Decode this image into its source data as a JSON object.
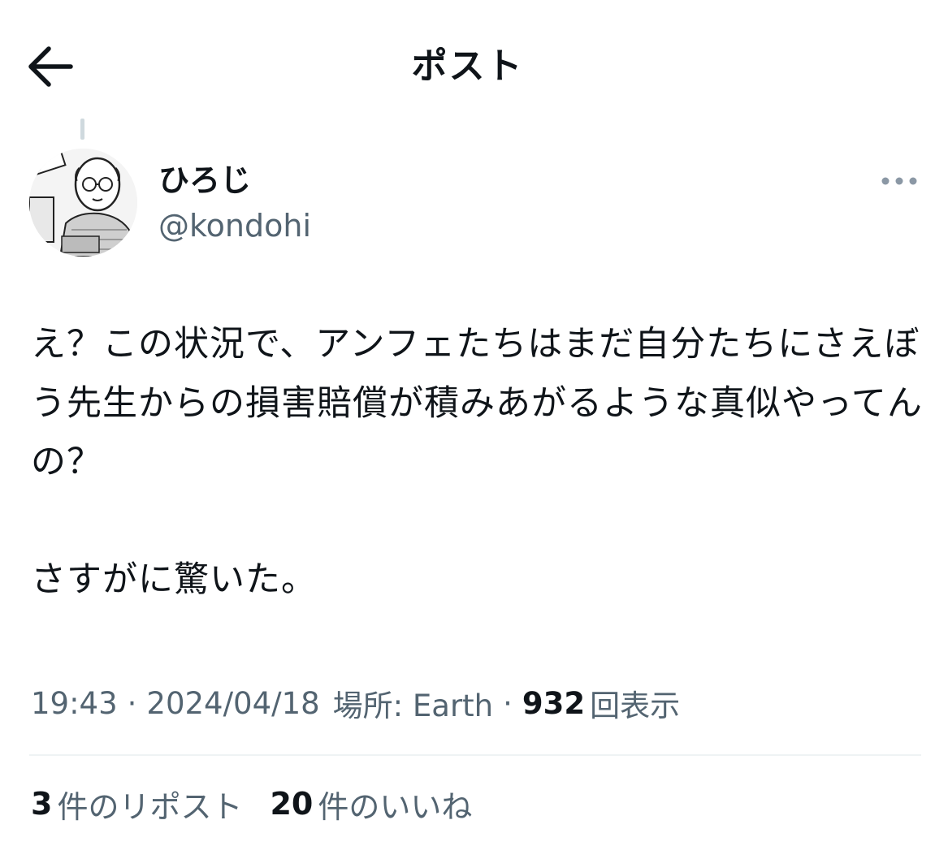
{
  "header": {
    "title": "ポスト",
    "back_icon": "arrow-left-icon"
  },
  "author": {
    "display_name": "ひろじ",
    "handle": "@kondohi",
    "avatar": "manga-style avatar",
    "more_icon": "more-dots-icon"
  },
  "post": {
    "text": "え？この状況で、アンフェたちはまだ自分たちにさえぼう先生からの損害賠償が積みあがるような真似やってんの？\n\nさすがに驚いた。"
  },
  "meta": {
    "time": "19:43",
    "separator": "·",
    "date": "2024/04/18",
    "location": "場所: Earth",
    "views_count": "932",
    "views_label": "回表示"
  },
  "stats": {
    "reposts_count": "3",
    "reposts_label": "件のリポスト",
    "likes_count": "20",
    "likes_label": "件のいいね"
  },
  "colors": {
    "text_primary": "#0f1419",
    "text_secondary": "#536471",
    "divider": "#eff3f4",
    "thread_line": "#cfd9de"
  }
}
